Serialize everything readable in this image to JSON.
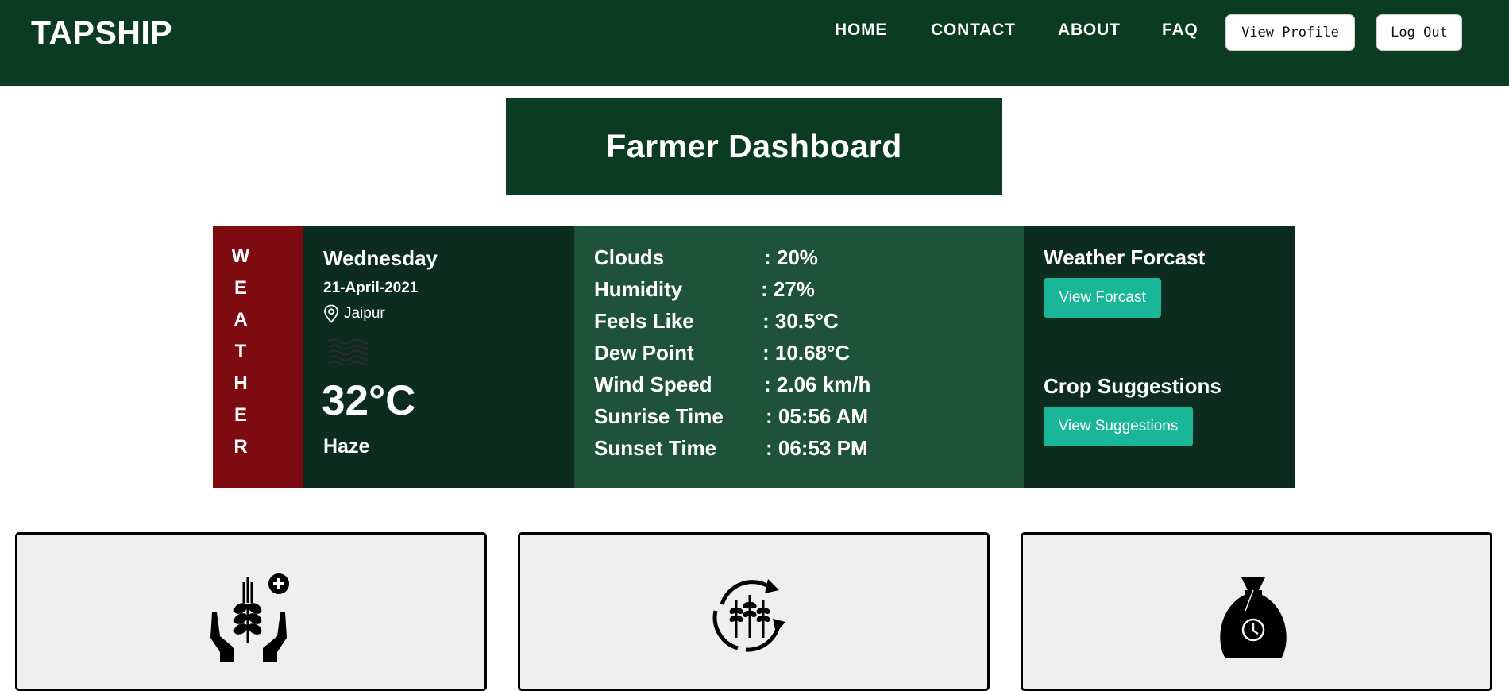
{
  "navbar": {
    "brand": "TAPSHIP",
    "links": [
      "HOME",
      "CONTACT",
      "ABOUT",
      "FAQ"
    ],
    "buttons": {
      "profile": "View Profile",
      "logout": "Log Out"
    }
  },
  "page_title": "Farmer Dashboard",
  "weather": {
    "strip_letters": [
      "W",
      "E",
      "A",
      "T",
      "H",
      "E",
      "R"
    ],
    "day": "Wednesday",
    "date": "21-April-2021",
    "location": "Jaipur",
    "temperature": "32°C",
    "condition": "Haze",
    "details": [
      {
        "label": "Clouds",
        "value": ": 20%"
      },
      {
        "label": "Humidity",
        "value": ": 27%"
      },
      {
        "label": "Feels Like",
        "value": ": 30.5°C"
      },
      {
        "label": "Dew Point",
        "value": ": 10.68°C"
      },
      {
        "label": "Wind Speed",
        "value": ": 2.06 km/h"
      },
      {
        "label": "Sunrise Time",
        "value": ": 05:56 AM"
      },
      {
        "label": "Sunset Time",
        "value": ": 06:53 PM"
      }
    ],
    "forecast": {
      "title": "Weather Forcast",
      "button": "View Forcast"
    },
    "crops": {
      "title": "Crop Suggestions",
      "button": "View Suggestions"
    }
  },
  "cards": [
    {
      "icon": "add-crop-icon"
    },
    {
      "icon": "crop-cycle-icon"
    },
    {
      "icon": "sack-history-icon"
    }
  ],
  "colors": {
    "header_green": "#0c3b23",
    "panel_dark": "#0b2c1e",
    "panel_mid": "#1f523a",
    "weather_red": "#7e0b0f",
    "button_teal": "#19b698",
    "card_bg": "#efefef"
  }
}
